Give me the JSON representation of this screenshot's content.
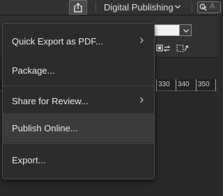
{
  "toolbar": {
    "share_icon": "share-export-icon",
    "workspace_label": "Digital Publishing",
    "workspace_chevron_icon": "chevron-down-icon",
    "search_icon": "search-icon",
    "search_placeholder": "A"
  },
  "ruler": {
    "tick_labels": [
      "330",
      "340",
      "350"
    ]
  },
  "menu": {
    "items": [
      {
        "label": "Quick Export as PDF...",
        "has_submenu": true
      },
      {
        "label": "Package...",
        "has_submenu": false
      },
      {
        "label": "Share for Review...",
        "has_submenu": true
      },
      {
        "label": "Publish Online...",
        "has_submenu": false
      },
      {
        "label": "Export...",
        "has_submenu": false
      }
    ],
    "highlighted_item": "Publish Online...",
    "submenu_icon": "chevron-right-icon"
  },
  "colors": {
    "menu_background": "#2c2c2c",
    "menu_highlight": "#3b3b3b",
    "toolbar_background": "#323232",
    "text": "#e8e8e8"
  }
}
